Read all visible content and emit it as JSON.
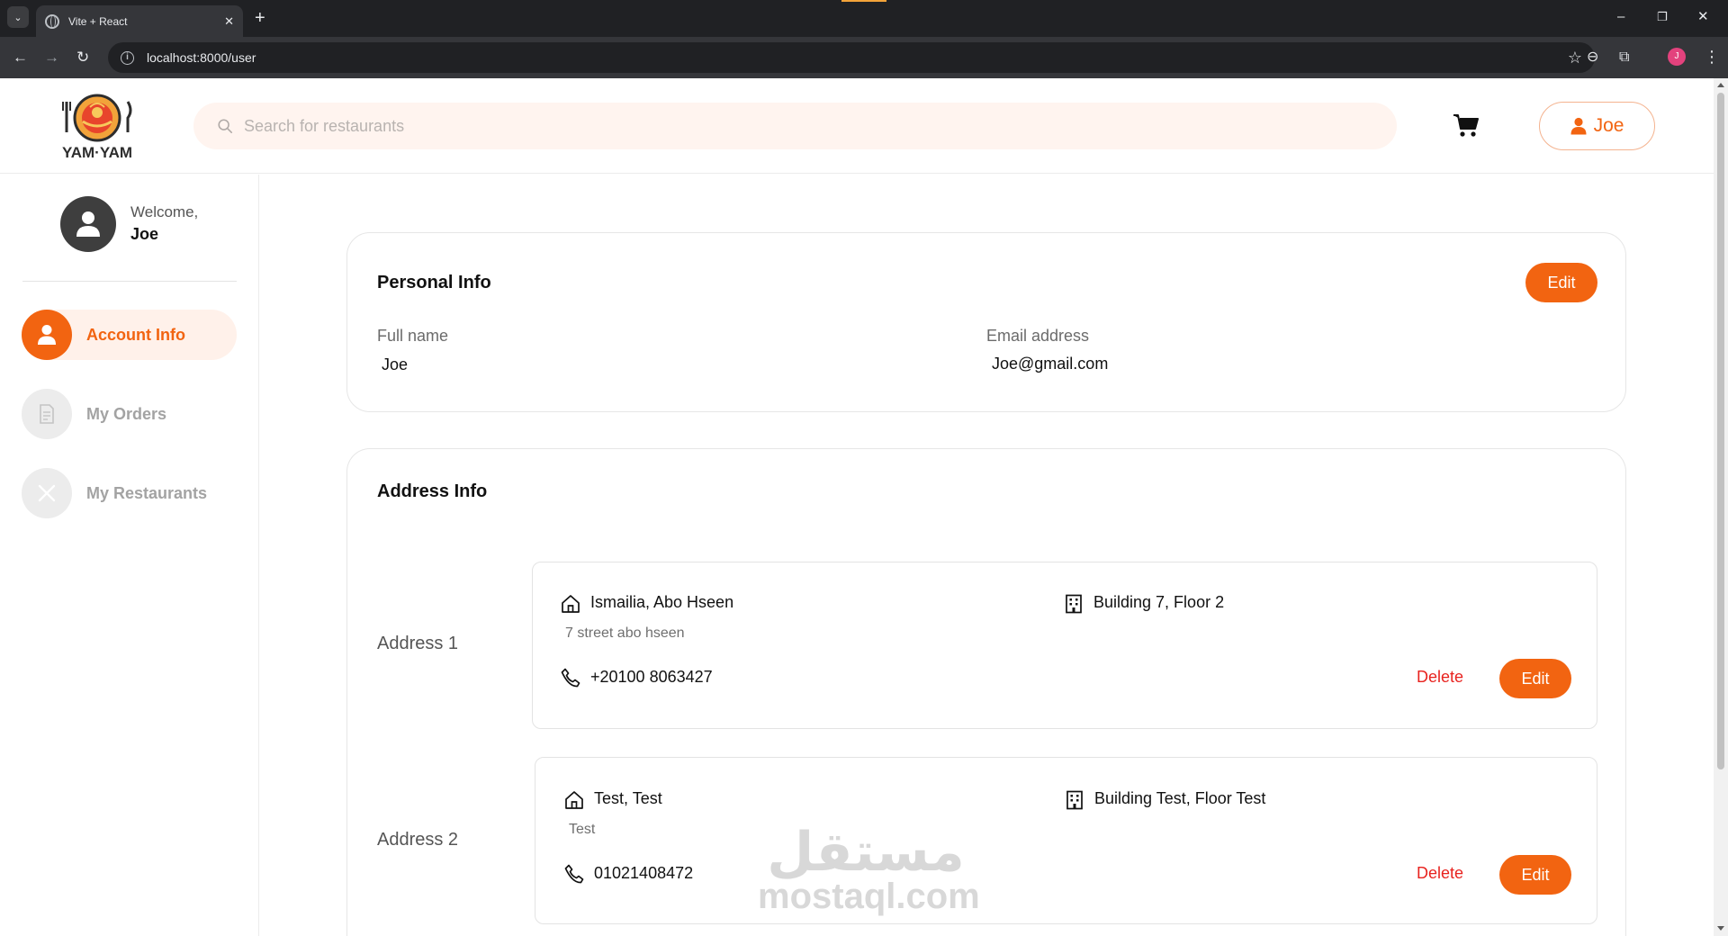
{
  "browser": {
    "tab_title": "Vite + React",
    "url": "localhost:8000/user",
    "profile_initial": "J"
  },
  "header": {
    "logo_text": "YAM·YAM",
    "search_placeholder": "Search for restaurants",
    "user_button_label": "Joe"
  },
  "sidebar": {
    "welcome": "Welcome,",
    "user_name": "Joe",
    "items": [
      {
        "label": "Account Info",
        "icon": "user-icon",
        "active": true
      },
      {
        "label": "My Orders",
        "icon": "document-icon",
        "active": false
      },
      {
        "label": "My Restaurants",
        "icon": "utensils-icon",
        "active": false
      }
    ]
  },
  "personal_info": {
    "title": "Personal Info",
    "edit_label": "Edit",
    "full_name_label": "Full name",
    "full_name": "Joe",
    "email_label": "Email address",
    "email": "Joe@gmail.com"
  },
  "address_info": {
    "title": "Address Info",
    "addresses": [
      {
        "label": "Address 1",
        "city_area": "Ismailia, Abo Hseen",
        "street": "7 street abo hseen",
        "building": "Building 7, Floor 2",
        "phone": "+20100 8063427",
        "delete_label": "Delete",
        "edit_label": "Edit"
      },
      {
        "label": "Address 2",
        "city_area": "Test, Test",
        "street": "Test",
        "building": "Building Test, Floor Test",
        "phone": "01021408472",
        "delete_label": "Delete",
        "edit_label": "Edit"
      }
    ]
  },
  "watermark": {
    "arabic": "مستقل",
    "latin": "mostaql.com"
  },
  "colors": {
    "accent": "#f26411",
    "accent_light": "#fff1ea",
    "delete": "#e8231f",
    "search_bg": "#fff4ef"
  }
}
